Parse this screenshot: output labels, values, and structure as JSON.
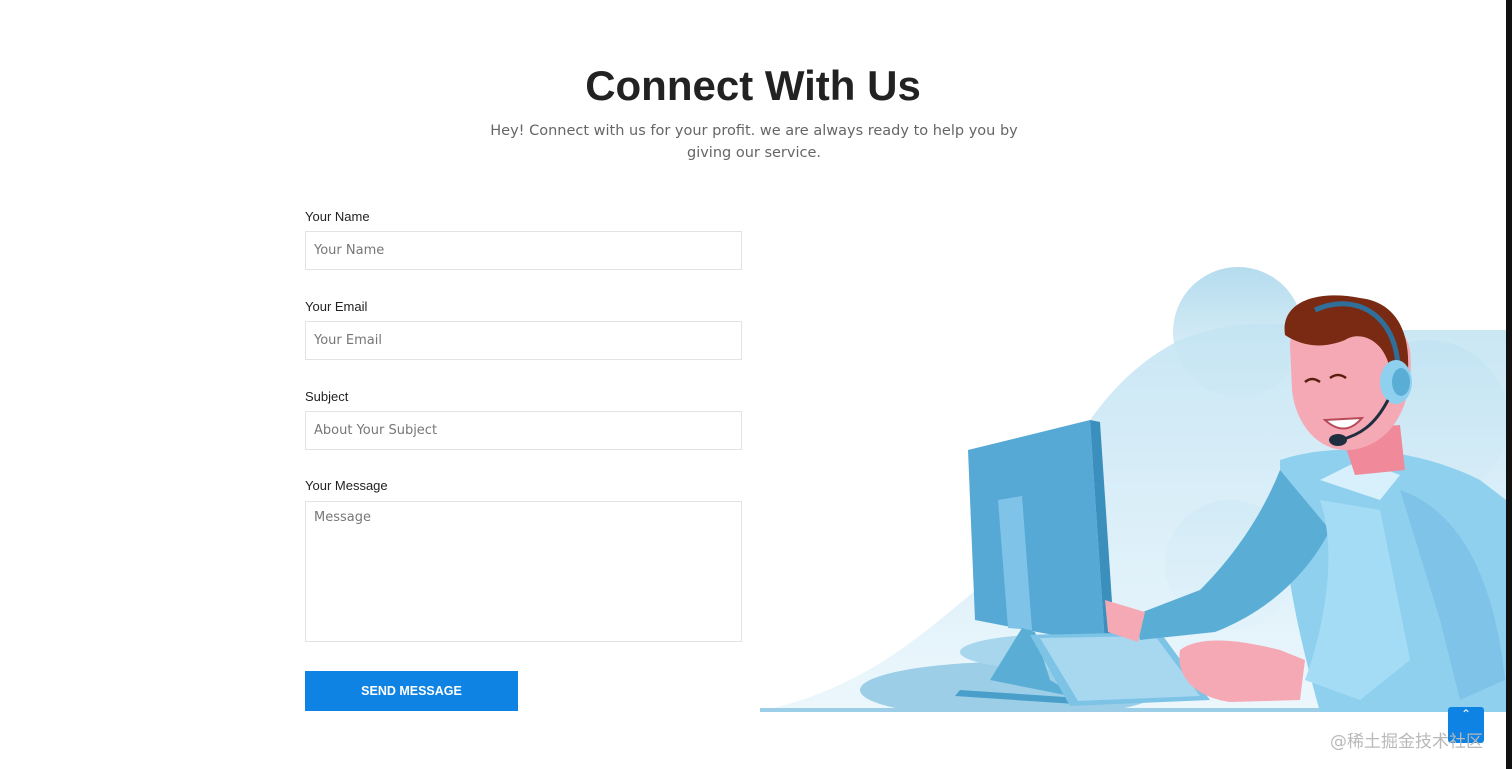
{
  "header": {
    "title": "Connect With Us",
    "subtitle": "Hey! Connect with us for your profit. we are always ready to help you by giving our service."
  },
  "form": {
    "name_label": "Your Name",
    "name_placeholder": "Your Name",
    "email_label": "Your Email",
    "email_placeholder": "Your Email",
    "subject_label": "Subject",
    "subject_placeholder": "About Your Subject",
    "message_label": "Your Message",
    "message_placeholder": "Message",
    "submit_label": "SEND MESSAGE"
  },
  "illustration": {
    "name": "customer-support-agent-illustration"
  },
  "back_to_top": {
    "icon": "chevron-up-icon",
    "glyph": "⌃"
  },
  "watermark": "@稀土掘金技术社区",
  "colors": {
    "accent": "#0f83e4",
    "title": "#222222",
    "subtitle": "#666666",
    "illustration_light_blue": "#8fd0ef",
    "illustration_blue": "#5aaed6"
  }
}
